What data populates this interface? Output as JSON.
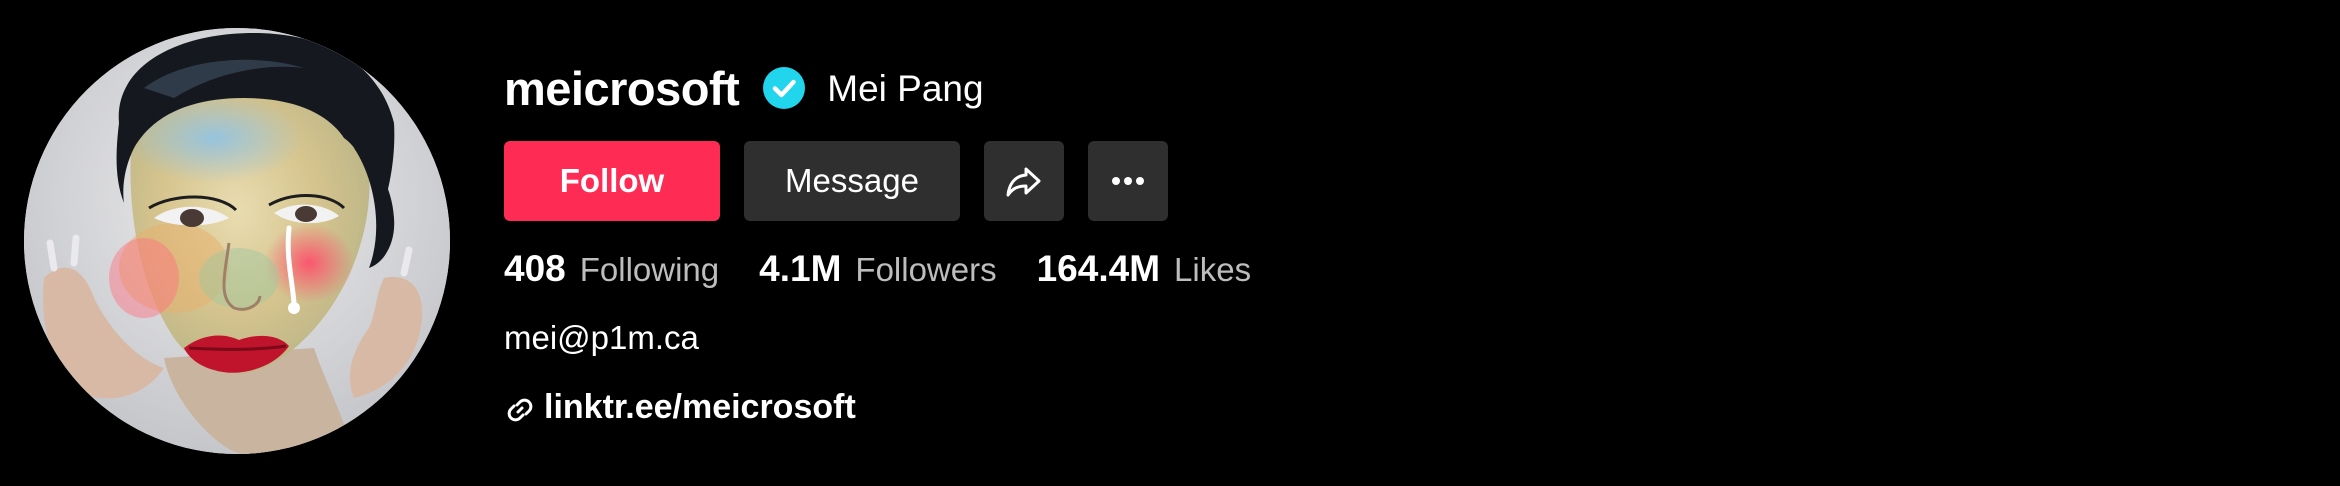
{
  "profile": {
    "username": "meicrosoft",
    "nickname": "Mei Pang",
    "verified": true,
    "verified_icon": "verified-check-icon",
    "avatar_icon": "profile-avatar"
  },
  "actions": {
    "follow_label": "Follow",
    "message_label": "Message",
    "share_icon": "share-arrow-icon",
    "more_icon": "more-dots-icon"
  },
  "stats": [
    {
      "value": "408",
      "label": "Following"
    },
    {
      "value": "4.1M",
      "label": "Followers"
    },
    {
      "value": "164.4M",
      "label": "Likes"
    }
  ],
  "bio": "mei@p1m.ca",
  "link": {
    "icon": "link-icon",
    "text": "linktr.ee/meicrosoft"
  },
  "colors": {
    "background": "#000000",
    "follow": "#fe2c55",
    "secondary_button": "#2f2f2f",
    "verified": "#20d5ec",
    "muted_text": "#bdbdbd"
  }
}
